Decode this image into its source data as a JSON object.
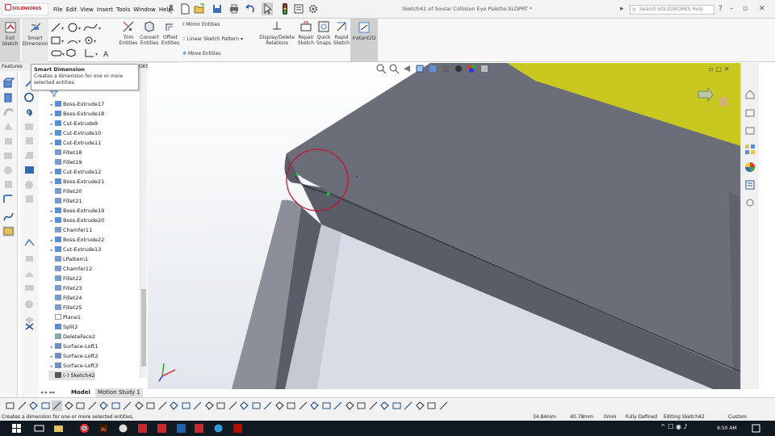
{
  "app": {
    "logo_text": "SOLIDWORKS",
    "document_title": "Sketch42 of Soular Collision Eye Palette.SLDPRT *",
    "search_placeholder": "Search SOLIDWORKS Help"
  },
  "menu": [
    "File",
    "Edit",
    "View",
    "Insert",
    "Tools",
    "Window",
    "Help"
  ],
  "command_manager": {
    "exit_sketch": [
      "Exit",
      "Sketch"
    ],
    "smart_dimension": [
      "Smart",
      "Dimension"
    ],
    "trim": [
      "Trim",
      "Entities"
    ],
    "convert": [
      "Convert",
      "Entities"
    ],
    "offset": [
      "Offset",
      "Entities"
    ],
    "mirror": "Mirror Entities",
    "linear_pattern": "Linear Sketch Pattern",
    "move": "Move Entities",
    "display_delete": [
      "Display/Delete",
      "Relations"
    ],
    "repair": [
      "Repair",
      "Sketch"
    ],
    "quick_snaps": [
      "Quick",
      "Snaps"
    ],
    "rapid_sketch": [
      "Rapid",
      "Sketch"
    ],
    "instant2d": "Instant2D"
  },
  "tabs": {
    "features": "Features",
    "addins": "OKS Add Ins"
  },
  "tooltip": {
    "title": "Smart Dimension",
    "body": "Creates a dimension for one or more selected entities."
  },
  "tree": [
    {
      "label": "Boss-Extrude17",
      "type": "boss",
      "exp": true
    },
    {
      "label": "Boss-Extrude18",
      "type": "boss",
      "exp": true
    },
    {
      "label": "Cut-Extrude9",
      "type": "cut",
      "exp": true
    },
    {
      "label": "Cut-Extrude10",
      "type": "cut",
      "exp": true
    },
    {
      "label": "Cut-Extrude11",
      "type": "cut",
      "exp": true
    },
    {
      "label": "Fillet18",
      "type": "fillet",
      "exp": false
    },
    {
      "label": "Fillet19",
      "type": "fillet",
      "exp": false
    },
    {
      "label": "Cut-Extrude12",
      "type": "cut",
      "exp": true
    },
    {
      "label": "Boss-Extrude21",
      "type": "boss",
      "exp": true
    },
    {
      "label": "Fillet20",
      "type": "fillet",
      "exp": false
    },
    {
      "label": "Fillet21",
      "type": "fillet",
      "exp": false
    },
    {
      "label": "Boss-Extrude19",
      "type": "boss",
      "exp": true
    },
    {
      "label": "Boss-Extrude20",
      "type": "boss",
      "exp": true
    },
    {
      "label": "Chamfer11",
      "type": "chamfer",
      "exp": false
    },
    {
      "label": "Boss-Extrude22",
      "type": "boss",
      "exp": true
    },
    {
      "label": "Cut-Extrude13",
      "type": "cut",
      "exp": true
    },
    {
      "label": "LPattern1",
      "type": "pattern",
      "exp": false
    },
    {
      "label": "Chamfer12",
      "type": "chamfer",
      "exp": false
    },
    {
      "label": "Fillet22",
      "type": "fillet",
      "exp": false
    },
    {
      "label": "Fillet23",
      "type": "fillet",
      "exp": false
    },
    {
      "label": "Fillet24",
      "type": "fillet",
      "exp": false
    },
    {
      "label": "Fillet25",
      "type": "fillet",
      "exp": false
    },
    {
      "label": "Plane1",
      "type": "plane",
      "exp": false
    },
    {
      "label": "Split2",
      "type": "split",
      "exp": false
    },
    {
      "label": "DeleteFace2",
      "type": "delete",
      "exp": false
    },
    {
      "label": "Surface-Loft1",
      "type": "surface",
      "exp": true
    },
    {
      "label": "Surface-Loft2",
      "type": "surface",
      "exp": true
    },
    {
      "label": "Surface-Loft3",
      "type": "surface",
      "exp": true
    },
    {
      "label": "(-) Sketch42",
      "type": "sketch",
      "exp": false
    }
  ],
  "bottom_tabs": {
    "model": "Model",
    "motion": "Motion Study 1"
  },
  "status": {
    "message": "Creates a dimension for one or more selected entities.",
    "x": "34.84mm",
    "y": "40.78mm",
    "z": "0mm",
    "definition": "Fully Defined",
    "editing": "Editing Sketch42",
    "units": "Custom"
  },
  "taskbar": {
    "time": "9:50 AM"
  },
  "colors": {
    "part_top": "#6b6e78",
    "part_side": "#595c66",
    "part_inner": "#d9dbe6",
    "yellow_face": "#c8c820",
    "highlight_circle": "#c8102e",
    "accent_red": "#c9282d"
  }
}
